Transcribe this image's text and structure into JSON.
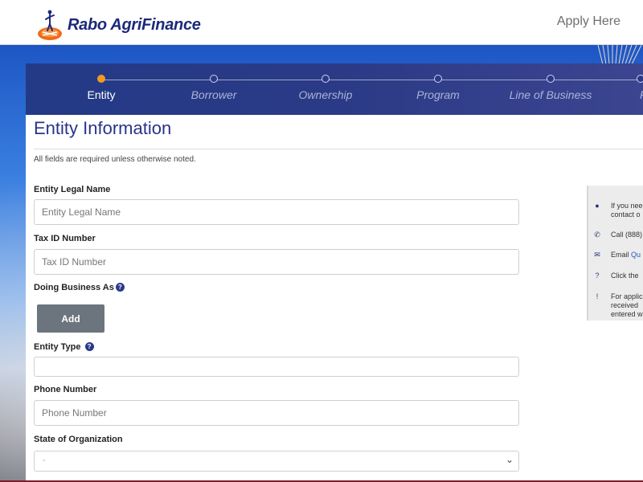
{
  "header": {
    "logo_text": "Rabo AgriFinance",
    "apply_label": "Apply Here"
  },
  "stepper": {
    "steps": [
      {
        "label": "Entity",
        "active": true
      },
      {
        "label": "Borrower",
        "active": false
      },
      {
        "label": "Ownership",
        "active": false
      },
      {
        "label": "Program",
        "active": false
      },
      {
        "label": "Line of Business",
        "active": false
      }
    ]
  },
  "form": {
    "title": "Entity Information",
    "required_note": "All fields are required unless otherwise noted.",
    "legal_name": {
      "label": "Entity Legal Name",
      "placeholder": "Entity Legal Name",
      "value": ""
    },
    "tax_id": {
      "label": "Tax ID Number",
      "placeholder": "Tax ID Number",
      "value": ""
    },
    "dba": {
      "label": "Doing Business As",
      "help": "?",
      "add_label": "Add"
    },
    "entity_type": {
      "label": "Entity Type",
      "help": "?",
      "value": ""
    },
    "phone": {
      "label": "Phone Number",
      "placeholder": "Phone Number",
      "value": ""
    },
    "state": {
      "label": "State of Organization",
      "selected": "-"
    }
  },
  "side_panel": {
    "items": [
      {
        "icon": "user-icon",
        "line1": "If you nee",
        "line2": "contact o"
      },
      {
        "icon": "phone-icon",
        "line1": "Call (888)"
      },
      {
        "icon": "envelope-icon",
        "line1": "Email ",
        "link": "Qu"
      },
      {
        "icon": "question-icon",
        "line1": "Click the"
      },
      {
        "icon": "info-icon",
        "line1": "For applic",
        "line2": "received",
        "line3": "entered w"
      }
    ]
  },
  "colors": {
    "brand_navy": "#29348a",
    "active_step": "#f39a21",
    "button_gray": "#6c757d"
  }
}
